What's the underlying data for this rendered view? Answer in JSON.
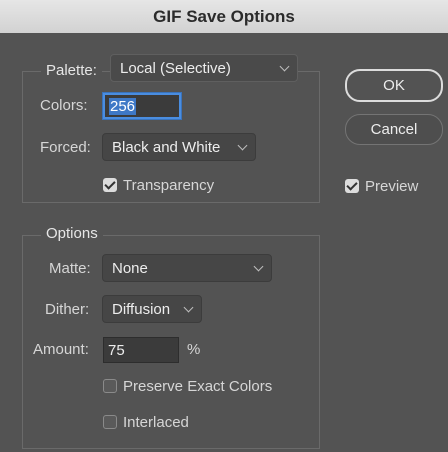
{
  "window": {
    "title": "GIF Save Options"
  },
  "palette_group": {
    "palette_label": "Palette:",
    "palette_value": "Local (Selective)",
    "colors_label": "Colors:",
    "colors_value": "256",
    "forced_label": "Forced:",
    "forced_value": "Black and White",
    "transparency_label": "Transparency",
    "transparency_checked": true
  },
  "options_group": {
    "title": "Options",
    "matte_label": "Matte:",
    "matte_value": "None",
    "dither_label": "Dither:",
    "dither_value": "Diffusion",
    "amount_label": "Amount:",
    "amount_value": "75",
    "amount_unit": "%",
    "preserve_label": "Preserve Exact Colors",
    "preserve_checked": false,
    "interlaced_label": "Interlaced",
    "interlaced_checked": false
  },
  "buttons": {
    "ok": "OK",
    "cancel": "Cancel"
  },
  "preview": {
    "label": "Preview",
    "checked": true
  },
  "colors": {
    "background": "#535353",
    "accent": "#4a8de0"
  }
}
